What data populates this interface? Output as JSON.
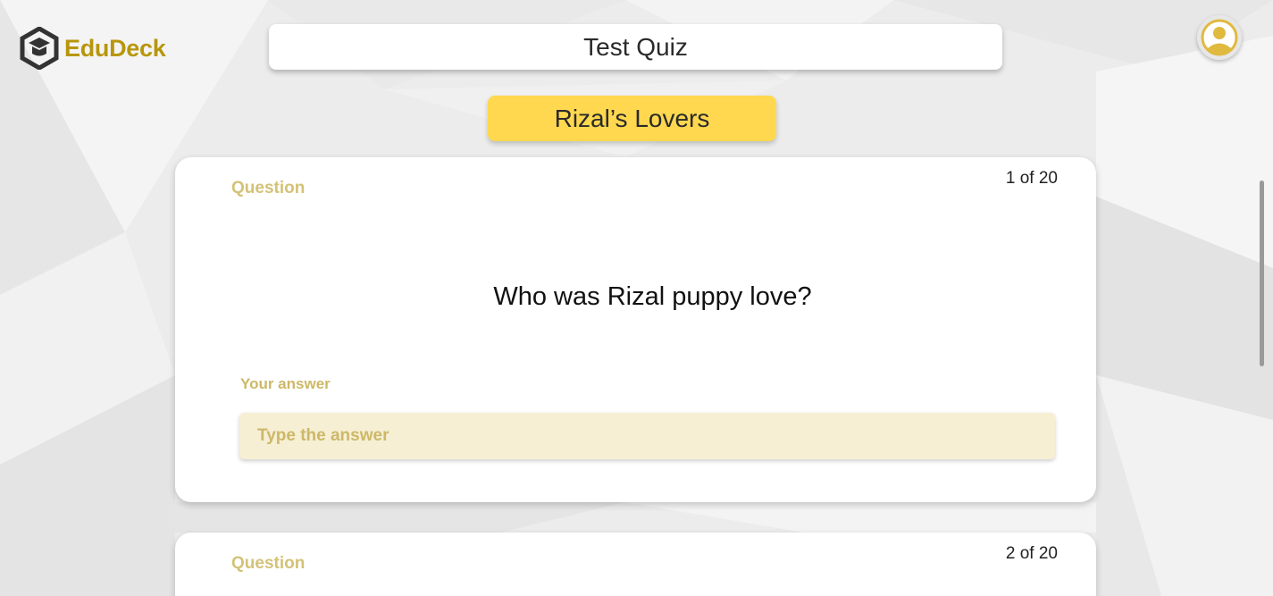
{
  "brand": {
    "name": "EduDeck",
    "color": "#b8960c"
  },
  "header": {
    "title": "Test Quiz"
  },
  "deck": {
    "name": "Rizal’s Lovers",
    "color": "#ffd84f"
  },
  "user": {
    "avatar_icon": "user-avatar-icon"
  },
  "questions": [
    {
      "label": "Question",
      "counter": "1 of 20",
      "text": "Who was Rizal puppy love?",
      "answer_label": "Your answer",
      "answer_placeholder": "Type the answer",
      "answer_value": ""
    },
    {
      "label": "Question",
      "counter": "2 of 20"
    }
  ]
}
